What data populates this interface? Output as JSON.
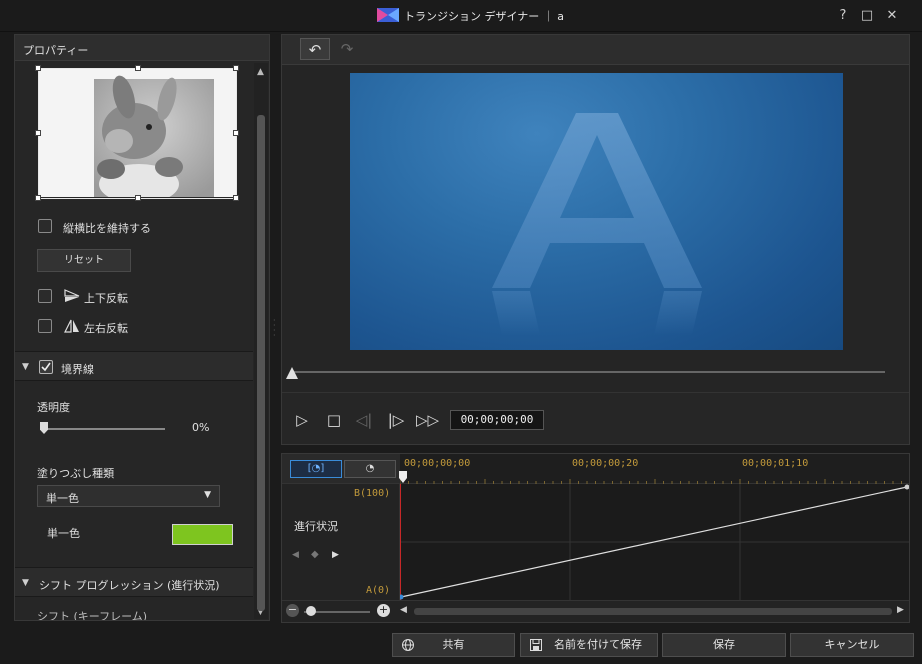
{
  "window": {
    "title": "トランジション デザイナー ｜ a",
    "help": "?",
    "maximize": "□",
    "close": "✕"
  },
  "properties": {
    "header": "プロパティー",
    "keep_aspect": "縦横比を維持する",
    "reset": "リセット",
    "flip_vertical": "上下反転",
    "flip_horizontal": "左右反転",
    "border_section": "境界線",
    "opacity_label": "透明度",
    "opacity_value": "0%",
    "opacity_level": 0,
    "fill_type_label": "塗りつぶし種類",
    "fill_type_value": "単一色",
    "single_color_label": "単一色",
    "single_color": "#7ec51f",
    "shift_section": "シフト プログレッション (進行状況)",
    "shift_keyframe": "シフト (キーフレーム)"
  },
  "preview": {
    "undo": "↶",
    "redo": "↷",
    "letter": "A",
    "timecode": "00;00;00;00"
  },
  "keyframes": {
    "tab1": "[◔]",
    "tab2": "◔",
    "ticks": [
      "00;00;00;00",
      "00;00;00;20",
      "00;00;01;10"
    ],
    "y_top": "B(100)",
    "y_bottom": "A(0)",
    "progress_label": "進行状況",
    "progress_start": 0,
    "progress_end": 100
  },
  "footer": {
    "share": "共有",
    "save_as": "名前を付けて保存",
    "save": "保存",
    "cancel": "キャンセル"
  },
  "colors": {
    "accent": "#3a8cd9",
    "playhead": "#c62828",
    "ruler_text": "#c29a3b"
  }
}
